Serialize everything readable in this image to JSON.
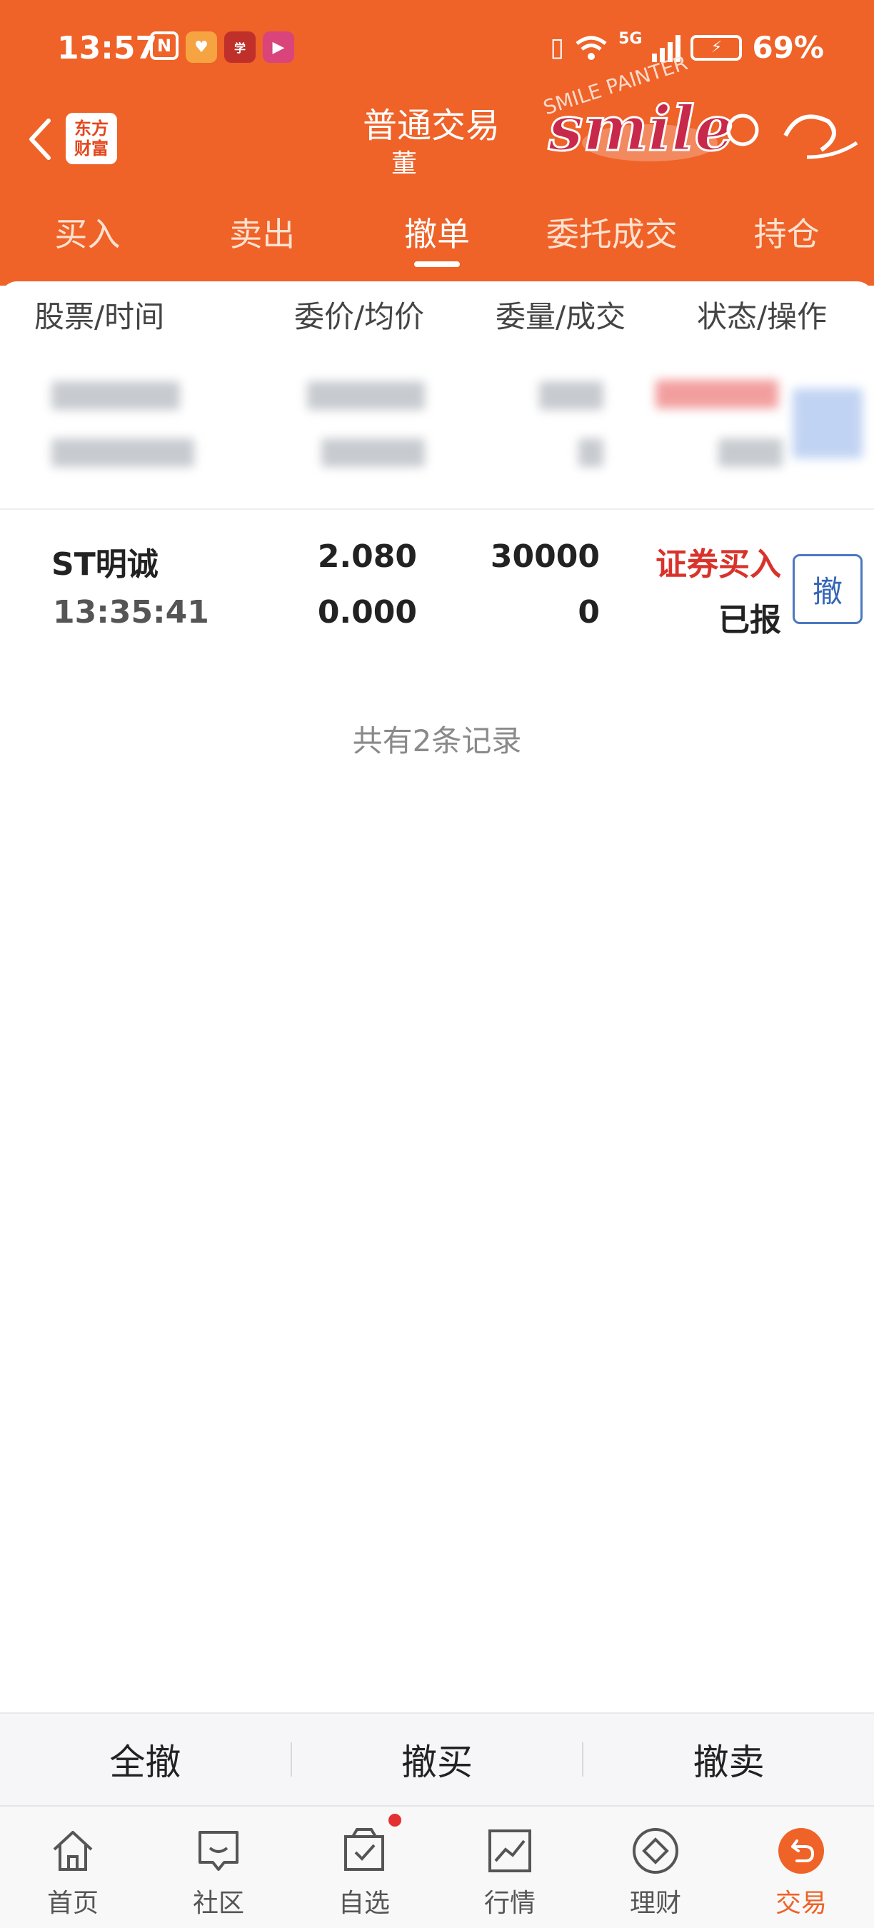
{
  "status_bar": {
    "time": "13:57",
    "network": "5G",
    "battery_percent": "69%"
  },
  "header": {
    "logo_line1": "东方",
    "logo_line2": "财富",
    "title": "普通交易",
    "subtitle": "董",
    "watermark_text": "smile",
    "watermark_caption": "SMILE PAINTER"
  },
  "tabs": [
    {
      "label": "买入"
    },
    {
      "label": "卖出"
    },
    {
      "label": "撤单"
    },
    {
      "label": "委托成交"
    },
    {
      "label": "持仓"
    }
  ],
  "active_tab": "撤单",
  "columns": {
    "stock_time": "股票/时间",
    "price_avg": "委价/均价",
    "qty_filled": "委量/成交",
    "status_action": "状态/操作"
  },
  "orders": [
    {
      "name": "ST明诚",
      "time": "13:35:41",
      "order_price": "2.080",
      "avg_price": "0.000",
      "order_qty": "30000",
      "filled_qty": "0",
      "type": "证券买入",
      "state": "已报",
      "action": "撤"
    }
  ],
  "record_count": "共有2条记录",
  "actions": {
    "cancel_all": "全撤",
    "cancel_buy": "撤买",
    "cancel_sell": "撤卖"
  },
  "nav": [
    {
      "label": "首页",
      "icon": "home-icon"
    },
    {
      "label": "社区",
      "icon": "community-icon"
    },
    {
      "label": "自选",
      "icon": "watchlist-icon"
    },
    {
      "label": "行情",
      "icon": "market-icon"
    },
    {
      "label": "理财",
      "icon": "finance-icon"
    },
    {
      "label": "交易",
      "icon": "trade-icon"
    }
  ],
  "colors": {
    "brand_orange": "#ef6228",
    "buy_red": "#d8332b",
    "cancel_blue": "#3465b8"
  }
}
